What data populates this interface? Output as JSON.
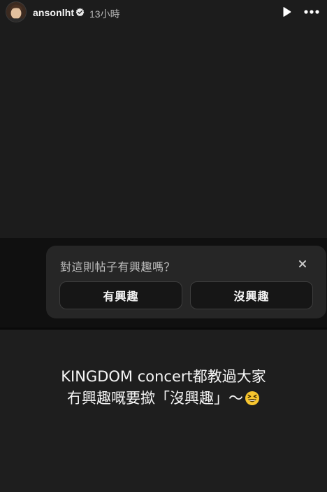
{
  "header": {
    "username": "ansonlht",
    "time_ago": "13小時",
    "verified_icon": "verified-badge-icon",
    "play_icon": "play-icon",
    "more_icon": "more-dots-icon"
  },
  "feedback": {
    "question": "對這則帖子有興趣嗎？",
    "close_icon": "close-icon",
    "interested_label": "有興趣",
    "not_interested_label": "沒興趣"
  },
  "caption": {
    "line1": "KINGDOM concert都教過大家",
    "line2": "冇興趣嘅要撳「沒興趣」～",
    "emoji_icon": "grinning-squinting-face-emoji"
  },
  "colors": {
    "background": "#1a1a1a",
    "card": "#262626",
    "button_border": "#3d3d3d",
    "emoji_yellow": "#f7c62f"
  }
}
